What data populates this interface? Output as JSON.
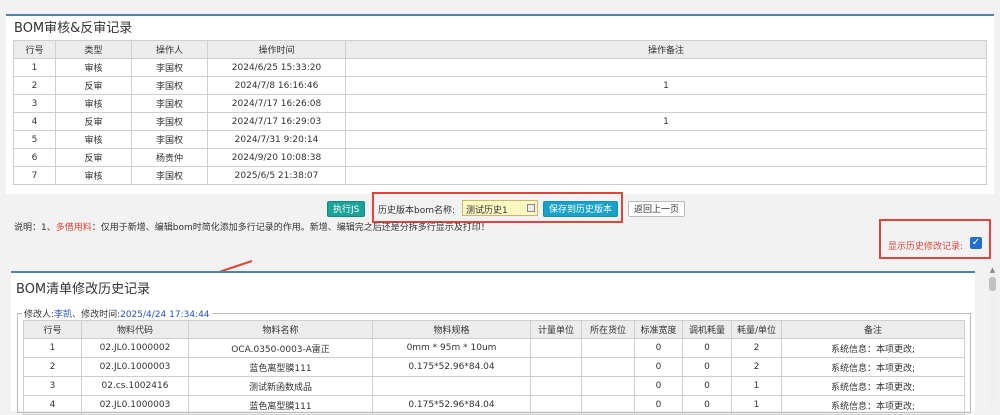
{
  "audit_panel": {
    "title": "BOM审核&反审记录",
    "columns": [
      "行号",
      "类型",
      "操作人",
      "操作时间",
      "操作备注"
    ],
    "rows": [
      [
        "1",
        "审核",
        "李国权",
        "2024/6/25 15:33:20",
        ""
      ],
      [
        "2",
        "反审",
        "李国权",
        "2024/7/8 16:16:46",
        "1"
      ],
      [
        "3",
        "审核",
        "李国权",
        "2024/7/17 16:26:08",
        ""
      ],
      [
        "4",
        "反审",
        "李国权",
        "2024/7/17 16:29:03",
        "1"
      ],
      [
        "5",
        "审核",
        "李国权",
        "2024/7/31 9:20:14",
        ""
      ],
      [
        "6",
        "反审",
        "杨贵仲",
        "2024/9/20 10:08:38",
        ""
      ],
      [
        "7",
        "审核",
        "李国权",
        "2025/6/5 21:38:07",
        ""
      ]
    ]
  },
  "toolbar": {
    "exec_js": "执行JS",
    "history_name_label": "历史版本bom名称:",
    "history_name_value": "测试历史1",
    "save_history": "保存到历史版本",
    "back": "返回上一页"
  },
  "note": {
    "prefix": "说明：1、",
    "highlight": "多借用料",
    "rest": "：仅用于新增、编辑bom时简化添加多行记录的作用。新增、编辑完之后还是分拆多行显示及打印！"
  },
  "show_history": {
    "label": "显示历史修改记录:",
    "checked": true
  },
  "history_panel": {
    "title": "BOM清单修改历史记录",
    "legend_prefix": "修改人:",
    "modifier": "李凯",
    "legend_mid": "、修改时间:",
    "modified_time": "2025/4/24 17:34:44",
    "columns": [
      "行号",
      "物料代码",
      "物料名称",
      "物料规格",
      "计量单位",
      "所在货位",
      "标准宽度",
      "调机耗量",
      "耗量/单位",
      "备注"
    ],
    "rows": [
      [
        "1",
        "02.JL0.1000002",
        "OCA.0350-0003-A雷正",
        "0mm * 95m * 10um",
        "",
        "",
        "0",
        "0",
        "2",
        "系统信息：本项更改;"
      ],
      [
        "2",
        "02.JL0.1000003",
        "蓝色离型膜111",
        "0.175*52.96*84.04",
        "",
        "",
        "0",
        "0",
        "2",
        "系统信息：本项更改;"
      ],
      [
        "3",
        "02.cs.1002416",
        "测试新函数成品",
        "",
        "",
        "",
        "0",
        "0",
        "1",
        "系统信息：本项更改;"
      ],
      [
        "4",
        "02.JL0.1000003",
        "蓝色离型膜111",
        "0.175*52.96*84.04",
        "",
        "",
        "0",
        "0",
        "1",
        "系统信息：本项更改;"
      ]
    ]
  },
  "colors": {
    "accent": "#4a86a8",
    "red_annotation": "#e0443a",
    "btn_green": "#1aa39a",
    "btn_blue": "#17a2c9",
    "checkbox": "#1f6fd1"
  }
}
